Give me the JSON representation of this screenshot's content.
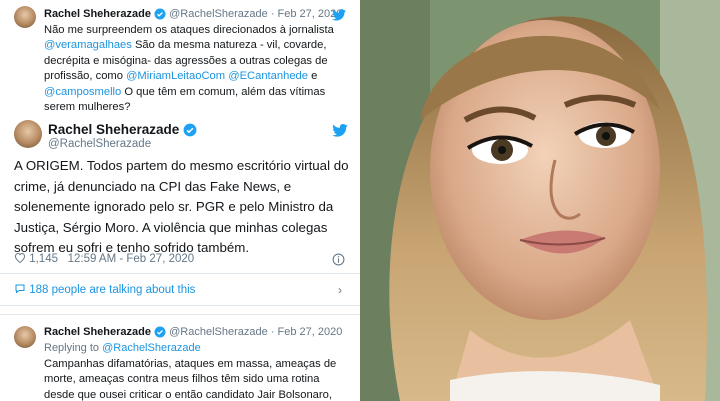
{
  "tweet1": {
    "name": "Rachel Sheherazade",
    "handle": "@RachelSherazade",
    "date": "· Feb 27, 2020",
    "text_parts": [
      "Não me surpreendem os ataques direcionados à jornalista ",
      "@veramagalhaes",
      " São da mesma natureza - vil, covarde, decrépita e misógina- das agressões a outras colegas de profissão, como ",
      "@MiriamLeitaoCom",
      " ",
      "@ECantanhede",
      " e ",
      "@camposmello",
      " O que têm em comum, além das vítimas serem mulheres?"
    ]
  },
  "main_tweet": {
    "name": "Rachel Sheherazade",
    "handle": "@RachelSherazade",
    "text": "A ORIGEM. Todos partem do mesmo escritório virtual do crime, já denunciado na CPI das Fake News, e solenemente ignorado pelo sr. PGR e pelo Ministro da Justiça, Sérgio Moro. A violência que minhas colegas sofrem eu sofri e tenho sofrido também.",
    "likes": "1,145",
    "time": "12:59 AM - Feb 27, 2020",
    "talking": "188 people are talking about this"
  },
  "tweet3": {
    "name": "Rachel Sheherazade",
    "handle": "@RachelSherazade",
    "date": "· Feb 27, 2020",
    "replying_prefix": "Replying to ",
    "replying_handle": "@RachelSherazade",
    "text": "Campanhas difamatórias, ataques em massa, ameaças de morte, ameaças contra meus filhos têm sido uma rotina desde que ousei criticar o então candidato Jair Bolsonaro, ainda no"
  },
  "colors": {
    "link": "#1b95e0",
    "muted": "#657786",
    "text": "#14171a",
    "twitter_blue": "#1da1f2"
  },
  "icons": [
    "avatar",
    "verified-badge-icon",
    "twitter-bird-icon",
    "heart-icon",
    "info-icon",
    "comment-icon",
    "chevron-right-icon"
  ]
}
